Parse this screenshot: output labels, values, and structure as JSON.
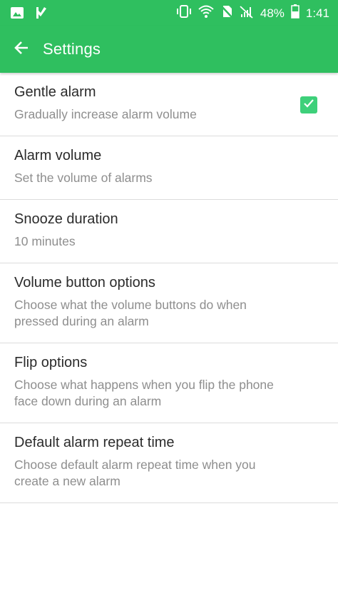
{
  "status_bar": {
    "battery": "48%",
    "time": "1:41"
  },
  "app_bar": {
    "title": "Settings"
  },
  "settings": [
    {
      "title": "Gentle alarm",
      "summary": "Gradually increase alarm volume",
      "checked": true
    },
    {
      "title": "Alarm volume",
      "summary": "Set the volume of alarms"
    },
    {
      "title": "Snooze duration",
      "summary": "10 minutes"
    },
    {
      "title": "Volume button options",
      "summary": "Choose what the volume buttons do when pressed during an alarm"
    },
    {
      "title": "Flip options",
      "summary": "Choose what happens when you flip the phone face down during an alarm"
    },
    {
      "title": "Default alarm repeat time",
      "summary": "Choose default alarm repeat time when you create a new alarm"
    }
  ],
  "colors": {
    "primary": "#2fbf5f",
    "checkbox": "#3ed07a"
  },
  "icons": {
    "status_left": [
      "image-icon",
      "check-flag-icon"
    ],
    "status_right": [
      "vibrate-icon",
      "wifi-icon",
      "no-sim-icon",
      "no-signal-icon",
      "battery-icon"
    ],
    "nav": "back-arrow-icon"
  }
}
